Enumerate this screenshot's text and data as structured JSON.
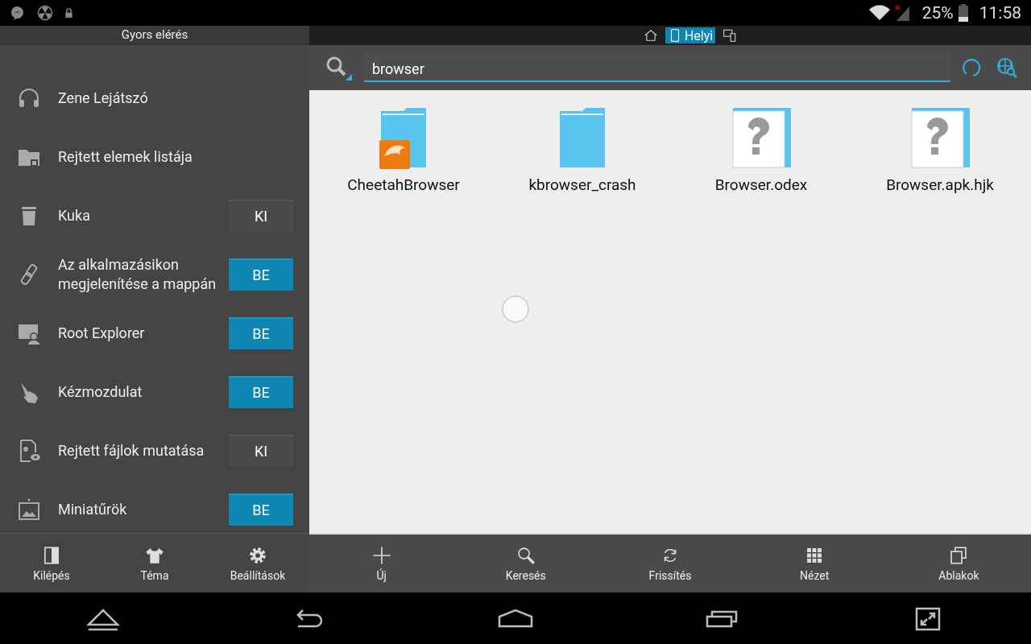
{
  "status_bar": {
    "battery": "25%",
    "time": "11:58"
  },
  "sidebar": {
    "title": "Gyors elérés",
    "items": [
      {
        "kind": "headphones",
        "label": "Zene Lejátszó"
      },
      {
        "kind": "folder",
        "label": "Rejtett elemek listája"
      },
      {
        "kind": "trash",
        "label": "Kuka",
        "toggle": {
          "label": "KI",
          "on": false
        }
      },
      {
        "kind": "link",
        "label": "Az alkalmazásikon megjelenítése a mappán",
        "toggle": {
          "label": "BE",
          "on": true
        }
      },
      {
        "kind": "root",
        "label": "Root Explorer",
        "toggle": {
          "label": "BE",
          "on": true
        }
      },
      {
        "kind": "hand",
        "label": "Kézmozdulat",
        "toggle": {
          "label": "BE",
          "on": true
        }
      },
      {
        "kind": "hidden",
        "label": "Rejtett fájlok mutatása",
        "toggle": {
          "label": "KI",
          "on": false
        }
      },
      {
        "kind": "image",
        "label": "Miniatűrök",
        "toggle": {
          "label": "BE",
          "on": true
        }
      }
    ],
    "toolbar": [
      {
        "kind": "exit",
        "label": "Kilépés"
      },
      {
        "kind": "shirt",
        "label": "Téma"
      },
      {
        "kind": "gear",
        "label": "Beállítások"
      }
    ]
  },
  "location_tabs": [
    {
      "kind": "home",
      "selected": false
    },
    {
      "kind": "phone",
      "label": "Helyi",
      "selected": true
    },
    {
      "kind": "devices",
      "selected": false
    }
  ],
  "search": {
    "value": "browser"
  },
  "files": [
    {
      "kind": "folder",
      "name": "CheetahBrowser",
      "badge": true
    },
    {
      "kind": "folder",
      "name": "kbrowser_crash"
    },
    {
      "kind": "unknown",
      "name": "Browser.odex"
    },
    {
      "kind": "unknown",
      "name": "Browser.apk.hjk"
    }
  ],
  "toolbar": [
    {
      "kind": "plus",
      "label": "Új"
    },
    {
      "kind": "search",
      "label": "Keresés"
    },
    {
      "kind": "refresh",
      "label": "Frissítés"
    },
    {
      "kind": "grid",
      "label": "Nézet"
    },
    {
      "kind": "windows",
      "label": "Ablakok"
    }
  ]
}
